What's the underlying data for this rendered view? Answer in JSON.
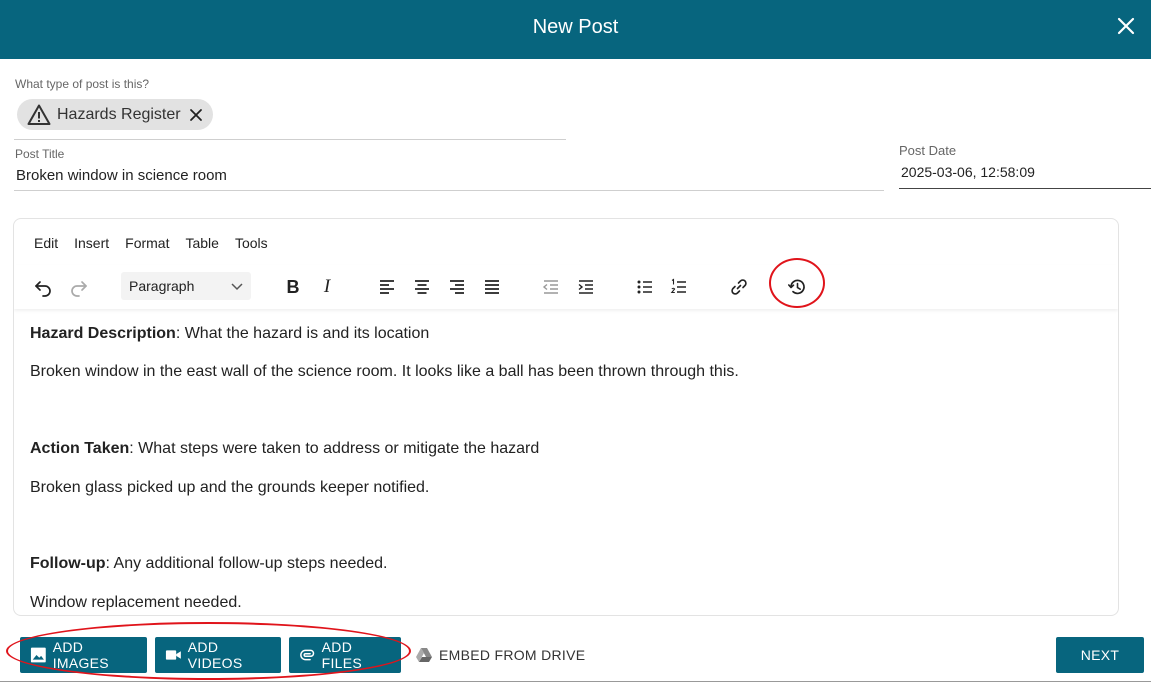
{
  "header": {
    "title": "New Post"
  },
  "post_type": {
    "label": "What type of post is this?",
    "chip_label": "Hazards Register"
  },
  "post_title": {
    "label": "Post Title",
    "value": "Broken window in science room"
  },
  "post_date": {
    "label": "Post Date",
    "value": "2025-03-06, 12:58:09"
  },
  "editor": {
    "menu": [
      "Edit",
      "Insert",
      "Format",
      "Table",
      "Tools"
    ],
    "block_format": "Paragraph",
    "content": {
      "hazard_heading": "Hazard Description",
      "hazard_prompt": ": What the hazard is and its location",
      "hazard_text": "Broken window in the east wall of the science room. It looks like a ball has been thrown through this.",
      "action_heading": "Action Taken",
      "action_prompt": ": What steps were taken to address or mitigate the hazard",
      "action_text": "Broken glass picked up and the grounds keeper notified.",
      "follow_heading": "Follow-up",
      "follow_prompt": ": Any additional follow-up steps needed.",
      "follow_text": "Window replacement needed."
    }
  },
  "actions": {
    "add_images": "ADD IMAGES",
    "add_videos": "ADD VIDEOS",
    "add_files": "ADD FILES",
    "embed_drive": "EMBED FROM DRIVE",
    "next": "NEXT"
  },
  "colors": {
    "primary": "#07657e",
    "annotation": "#e0141b"
  }
}
